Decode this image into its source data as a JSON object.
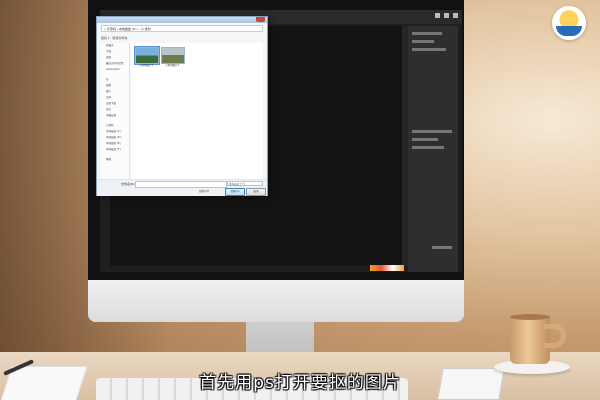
{
  "subtitle": "首先用ps打开要抠的图片",
  "dialog": {
    "address": "« 计算机 › 本地磁盘 (D:) › 小 素材",
    "toolbar": [
      "组织 ▾",
      "新建文件夹"
    ],
    "tree_items": [
      "收藏夹",
      "下载",
      "桌面",
      "最近访问的位置",
      "Subversion",
      "",
      "库",
      "视频",
      "图片",
      "文档",
      "迅雷下载",
      "音乐",
      "天翼云盘",
      "",
      "计算机",
      "本地磁盘 (C:)",
      "本地磁盘 (D:)",
      "本地磁盘 (E:)",
      "本地磁盘 (F:)",
      "",
      "网络"
    ],
    "files": [
      {
        "name": "小素材图片1"
      },
      {
        "name": "小素材图片2"
      }
    ],
    "filename_label": "文件名(N):",
    "filetype_value": "所有格式 (*.*)",
    "sequence_label": "图像序列",
    "open_button": "打开(O)",
    "cancel_button": "取消"
  },
  "colors": {
    "dialog_accent": "#5c95d3",
    "ps_bg": "#1e1e1e",
    "subtitle": "#ffffff"
  },
  "icons": [
    "logo-icon",
    "close-icon",
    "folder-icon",
    "image-thumbnail-icon",
    "pen-icon",
    "mug-icon"
  ]
}
